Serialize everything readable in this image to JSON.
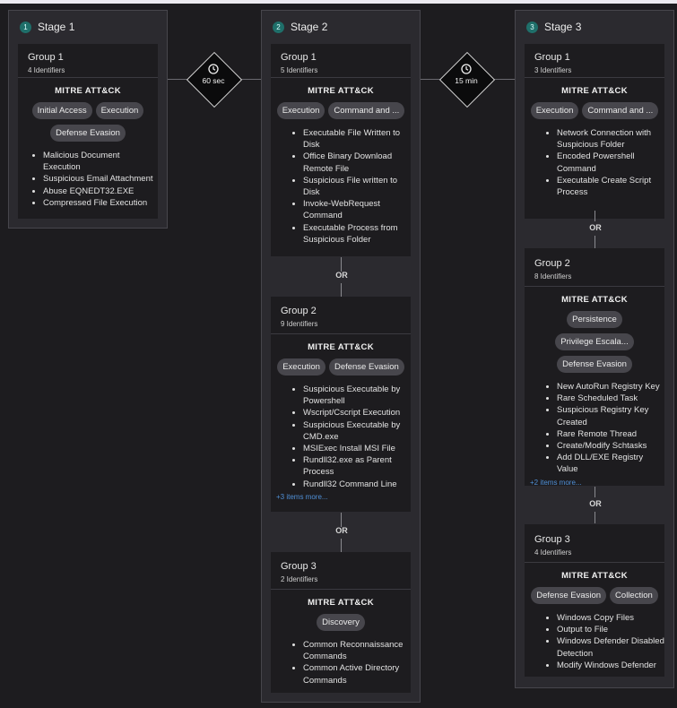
{
  "stages": [
    {
      "number": "1",
      "title": "Stage 1",
      "groups": [
        {
          "title": "Group 1",
          "subtitle": "4 Identifiers",
          "mitre_label": "MITRE ATT&CK",
          "tags": [
            "Initial Access",
            "Execution",
            "Defense Evasion"
          ],
          "items": [
            "Malicious Document Execution",
            "Suspicious Email Attachment",
            "Abuse EQNEDT32.EXE",
            "Compressed File Execution"
          ]
        }
      ]
    },
    {
      "number": "2",
      "title": "Stage 2",
      "groups": [
        {
          "title": "Group 1",
          "subtitle": "5 Identifiers",
          "mitre_label": "MITRE ATT&CK",
          "tags": [
            "Execution",
            "Command and ..."
          ],
          "items": [
            "Executable File Written to Disk",
            "Office Binary Download Remote File",
            "Suspicious File written to Disk",
            "Invoke-WebRequest Command",
            "Executable Process from Suspicious Folder"
          ]
        },
        {
          "title": "Group 2",
          "subtitle": "9 Identifiers",
          "mitre_label": "MITRE ATT&CK",
          "tags": [
            "Execution",
            "Defense Evasion"
          ],
          "items": [
            "Suspicious Executable by Powershell",
            "Wscript/Cscript Execution",
            "Suspicious Executable by CMD.exe",
            "MSIExec Install MSI File",
            "Rundll32.exe as Parent Process",
            "Rundll32 Command Line"
          ],
          "more": "+3 items more..."
        },
        {
          "title": "Group 3",
          "subtitle": "2 Identifiers",
          "mitre_label": "MITRE ATT&CK",
          "tags": [
            "Discovery"
          ],
          "items": [
            "Common Reconnaissance Commands",
            "Common Active Directory Commands"
          ]
        }
      ]
    },
    {
      "number": "3",
      "title": "Stage 3",
      "groups": [
        {
          "title": "Group 1",
          "subtitle": "3 Identifiers",
          "mitre_label": "MITRE ATT&CK",
          "tags": [
            "Execution",
            "Command and ..."
          ],
          "items": [
            "Network Connection with Suspicious Folder",
            "Encoded Powershell Command",
            "Executable Create Script Process"
          ]
        },
        {
          "title": "Group 2",
          "subtitle": "8 Identifiers",
          "mitre_label": "MITRE ATT&CK",
          "tags": [
            "Persistence",
            "Privilege Escala...",
            "Defense Evasion"
          ],
          "items": [
            "New AutoRun Registry Key",
            "Rare Scheduled Task",
            "Suspicious Registry Key Created",
            "Rare Remote Thread",
            "Create/Modify Schtasks",
            "Add DLL/EXE Registry Value"
          ],
          "more": "+2 items more..."
        },
        {
          "title": "Group 3",
          "subtitle": "4 Identifiers",
          "mitre_label": "MITRE ATT&CK",
          "tags": [
            "Defense Evasion",
            "Collection"
          ],
          "items": [
            "Windows Copy Files",
            "Output to File",
            "Windows Defender Disabled Detection",
            "Modify Windows Defender"
          ]
        }
      ]
    }
  ],
  "or_label": "OR",
  "timers": [
    {
      "label": "60 sec",
      "icon": "clock-icon"
    },
    {
      "label": "15 min",
      "icon": "clock-icon"
    }
  ]
}
